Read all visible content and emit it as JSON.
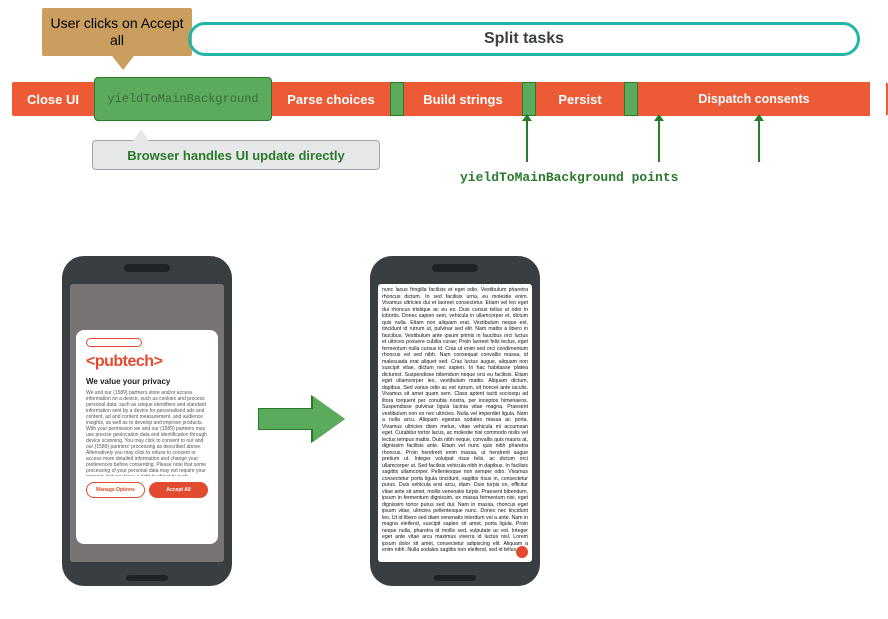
{
  "callout": "User clicks on Accept all",
  "pill": "Split tasks",
  "tasks": {
    "close_ui": "Close UI",
    "yield_block": "yieldToMainBackground",
    "parse": "Parse choices",
    "build": "Build strings",
    "persist": "Persist",
    "dispatch": "Dispatch consents"
  },
  "grey_box": "Browser handles UI update directly",
  "yield_label": "yieldToMainBackground points",
  "consent": {
    "logo": "<pubtech>",
    "headline": "We value your privacy",
    "body": "We and our (1589) partners store and/or access information on a device, such as cookies and process personal data, such as unique identifiers and standard information sent by a device for personalised ads and content, ad and content measurement, and audience insights, as well as to develop and improve products. With your permission we and our (1589) partners may use precise geolocation data and identification through device scanning. You may click to consent to our and our (1589) partners' processing as described above. Alternatively you may click to refuse to consent or access more detailed information and change your preferences before consenting. Please note that some processing of your personal data may not require your consent, but you have a right to object to such processing. Your preferences will apply across the web. You can",
    "manage": "Manage Options",
    "accept": "Accept All"
  },
  "lorem": "nunc lacus fringilla facilisis et eget odio. Vestibulum pharetra rhoncus dictum. In sed facilisis urna, eu molestie enim. Vivamus ultricies dui et laoreet consectetur. Etiam vel leo eget dui rhoncus tristique ac eu ex. Duis cursus tellus ut odio in lobortis. Donec sapien sem, vehicula in ullamcorper et, dictum quis nulla. Etiam non aliquam erat. Vestibulum neque est, tincidunt id rutrum ut, pulvinar sed elit. Nam mattis a libero in faucibus. Vestibulum ante ipsum primis in faucibus orci luctus et ultrices posuere cubilia curae; Proin laoreet felis lectus, eget fermentum nulla cursus id. Cras ut enim sed orci condimentum rhoncus vel sed nibh. Nam consequat convallis massa, id malesuada erat aliquet sed. Cras luctus augue, aliquam non suscipit vitae, dictum nec sapien. In hac habitasse platea dictumst. Suspendisse bibendum neque orci eu facilisis. Etiam eget ullamcorper leo, vestibulum mattis. Aliquam dictum, dapibus. Sed varius odio ac est rutrum, sit honcet ante iaculis. Vivamus sit amet quam sem. Class aptent taciti sociosqu ad litora torquent per conubia nostra, per inceptos himenaeos. Suspendisse pulvinar ligula lacinia vitae magna. Praesent vestibulum non ex nec ultricies. Nulla vel imperdiet ligula. Nam a nulla arcu. Aliquam egestas sodales massa ac porta. Vivamus ultricies diam metus, vitae vehicula mi accumsan eget. Curabitur tortor lacus, ac molestie nisi commodo nislis vel lectus tempus mattis. Duis nibh neque, convallis quis mauris at, dignissim facilisis ante. Etiam vel nunc quis nibh pharetra rhoncus. Proin hendrerit enim massa, ut hendrerit augue pretium ut. Integer volutpat risus felis, ac dictum orci ullamcorper ut. Sed facilisis vehicula nibh in dapibus. In facilisis sagittis ullamcorper. Pellentesque non semper odio. Vivamus consectetur porta ligula tincidunt, sagittis risus in, consectetur purus. Duis vehicula erat arcu, diam. Duis turpis ex, efficitur vitae ante sit amet, mollis venenatis turpis. Praesent bibendum, ipsum in fermentum dignissim, ex massa fermentum nisi, eget dignissim tortor purus sed dui. Nam in massa, rhoncus eget ipsum vitae, ultricies pellentesque nunc. Donec nec tincidunt leo. Ut id libero sed diam venenatis interdum vel a ante. Nam in magna eleifend, suscipit sapien sit amet, porta ligula. Proin neque nulla, pharetra id mollis sed, vulputate ac est. Integer eget ante vitae arcu maximus viverra id luctus nisl. Lorem ipsum dolor sit amet, consectetur adipiscing elit. Aliquam a enim nibh. Nulla sodales sagittis non eleifend, sed id tellus vel."
}
